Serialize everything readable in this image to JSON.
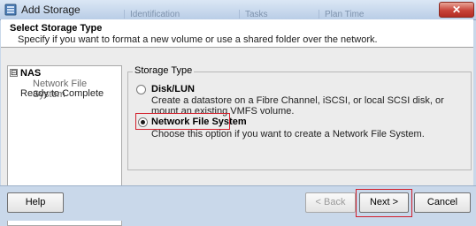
{
  "window": {
    "title": "Add Storage",
    "close_label": "✕",
    "background_tabs": [
      "Identification",
      "Tasks",
      "Plan Time"
    ]
  },
  "header": {
    "title": "Select Storage Type",
    "description": "Specify if you want to format a new volume or use a shared folder over the network."
  },
  "steps": {
    "toggle": "⊟",
    "items": [
      {
        "label": "NAS",
        "state": "current-group"
      },
      {
        "label": "Network File System",
        "state": "sub-step"
      },
      {
        "label": "Ready to Complete",
        "state": "pending"
      }
    ]
  },
  "storage_type": {
    "legend": "Storage Type",
    "options": [
      {
        "label": "Disk/LUN",
        "description": "Create a datastore on a Fibre Channel, iSCSI, or local SCSI disk, or mount an existing VMFS volume.",
        "selected": false
      },
      {
        "label": "Network File System",
        "description": "Choose this option if you want to create a Network File System.",
        "selected": true
      }
    ]
  },
  "buttons": {
    "help": "Help",
    "back": "< Back",
    "next": "Next >",
    "cancel": "Cancel"
  },
  "colors": {
    "highlight": "#d21f2b",
    "titlebar": "#c9d8ea"
  }
}
